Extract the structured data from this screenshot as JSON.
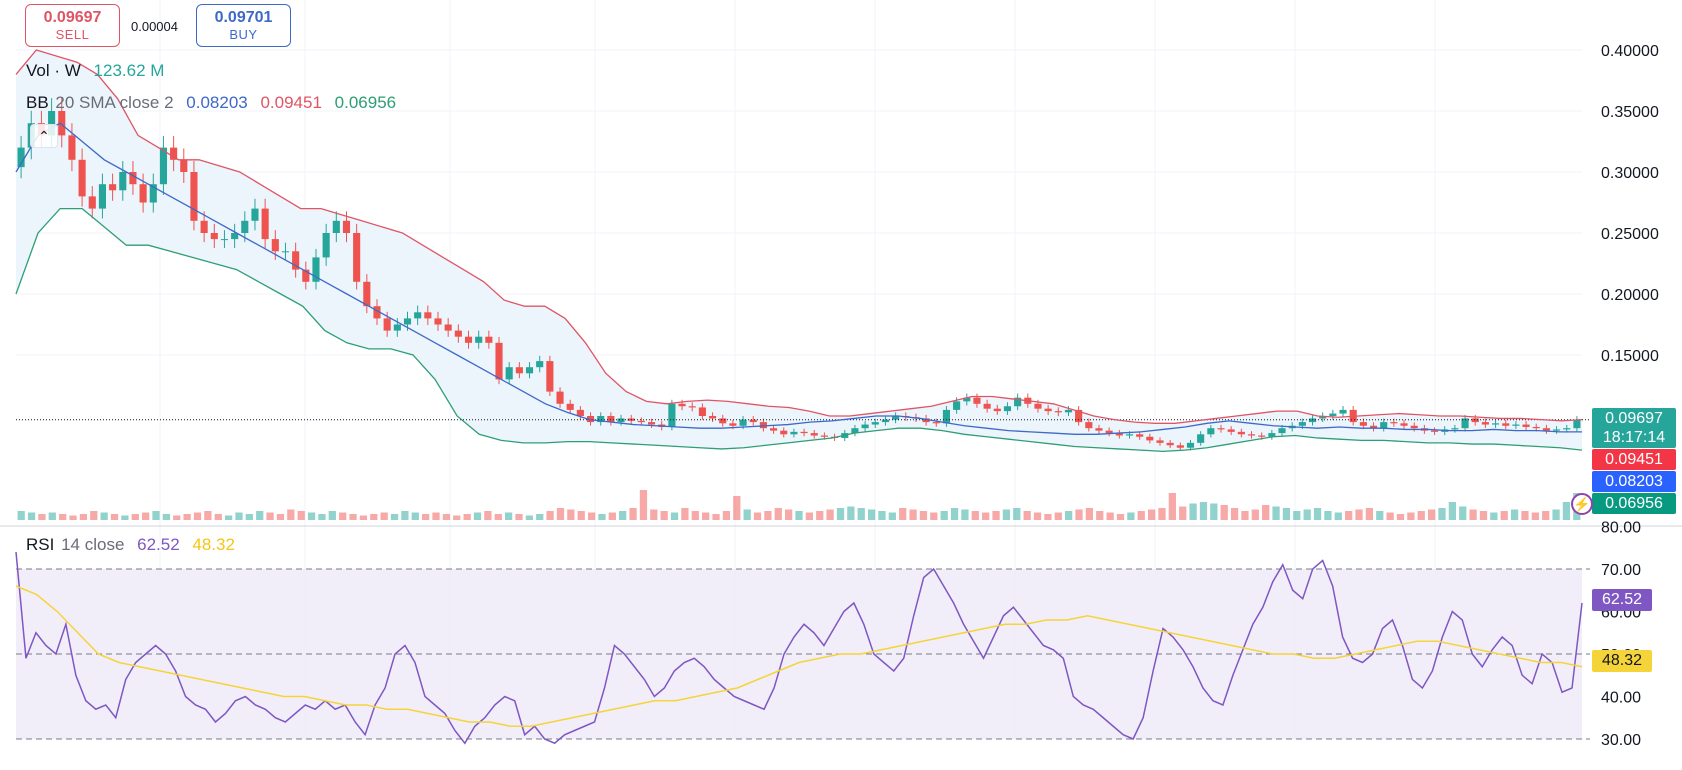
{
  "trade": {
    "sell_price": "0.09697",
    "sell_label": "SELL",
    "spread": "0.00004",
    "buy_price": "0.09701",
    "buy_label": "BUY"
  },
  "legends": {
    "vol_name": "Vol · W",
    "vol_value": "123.62 M",
    "bb_name": "BB",
    "bb_params": "20 SMA close 2",
    "bb_basis": "0.08203",
    "bb_upper": "0.09451",
    "bb_lower": "0.06956",
    "rsi_name": "RSI",
    "rsi_params": "14 close",
    "rsi_value": "62.52",
    "rsi_ma": "48.32"
  },
  "price_tags": {
    "last": "0.09697",
    "countdown": "18:17:14",
    "upper": "0.09451",
    "basis": "0.08203",
    "lower": "0.06956",
    "rsi": "62.52",
    "rsi_ma": "48.32"
  },
  "colors": {
    "up": "#26a69a",
    "down": "#ef5350",
    "upper_band": "#e05565",
    "basis": "#3d69c9",
    "lower_band": "#2e9e74",
    "rsi": "#7e57c2",
    "rsi_ma": "#f5d43a",
    "band_fill": "#eaf3fc",
    "rsi_fill": "#ede7f6"
  },
  "chart_data": [
    {
      "type": "candlestick",
      "interval": "W",
      "ylim": [
        0.06,
        0.41
      ],
      "y_ticks": [
        "0.40000",
        "0.35000",
        "0.30000",
        "0.25000",
        "0.20000",
        "0.15000"
      ],
      "last_price": 0.09697,
      "close": [
        0.32,
        0.34,
        0.33,
        0.35,
        0.33,
        0.31,
        0.28,
        0.27,
        0.29,
        0.285,
        0.3,
        0.29,
        0.275,
        0.29,
        0.32,
        0.31,
        0.3,
        0.26,
        0.25,
        0.245,
        0.245,
        0.25,
        0.26,
        0.27,
        0.245,
        0.235,
        0.235,
        0.22,
        0.21,
        0.23,
        0.25,
        0.26,
        0.25,
        0.21,
        0.19,
        0.18,
        0.17,
        0.175,
        0.18,
        0.185,
        0.18,
        0.175,
        0.17,
        0.165,
        0.16,
        0.165,
        0.16,
        0.13,
        0.14,
        0.135,
        0.14,
        0.145,
        0.12,
        0.11,
        0.105,
        0.1,
        0.095,
        0.1,
        0.095,
        0.098,
        0.096,
        0.095,
        0.093,
        0.091,
        0.11,
        0.108,
        0.107,
        0.1,
        0.098,
        0.094,
        0.092,
        0.097,
        0.095,
        0.09,
        0.088,
        0.085,
        0.087,
        0.086,
        0.084,
        0.083,
        0.082,
        0.086,
        0.09,
        0.093,
        0.095,
        0.097,
        0.1,
        0.099,
        0.098,
        0.095,
        0.094,
        0.105,
        0.112,
        0.115,
        0.11,
        0.106,
        0.104,
        0.108,
        0.115,
        0.11,
        0.106,
        0.104,
        0.103,
        0.105,
        0.095,
        0.09,
        0.088,
        0.086,
        0.084,
        0.085,
        0.083,
        0.08,
        0.078,
        0.076,
        0.074,
        0.078,
        0.085,
        0.09,
        0.089,
        0.087,
        0.085,
        0.084,
        0.083,
        0.086,
        0.09,
        0.092,
        0.095,
        0.098,
        0.1,
        0.102,
        0.105,
        0.095,
        0.092,
        0.09,
        0.095,
        0.094,
        0.092,
        0.09,
        0.088,
        0.087,
        0.089,
        0.09,
        0.098,
        0.095,
        0.093,
        0.094,
        0.092,
        0.093,
        0.091,
        0.09,
        0.088,
        0.089,
        0.09,
        0.097
      ],
      "bb_upper_trace": [
        0.38,
        0.4,
        0.395,
        0.39,
        0.38,
        0.36,
        0.33,
        0.32,
        0.31,
        0.31,
        0.305,
        0.3,
        0.29,
        0.28,
        0.27,
        0.27,
        0.265,
        0.26,
        0.255,
        0.25,
        0.24,
        0.23,
        0.22,
        0.21,
        0.195,
        0.19,
        0.19,
        0.18,
        0.16,
        0.135,
        0.12,
        0.112,
        0.11,
        0.112,
        0.113,
        0.112,
        0.11,
        0.108,
        0.107,
        0.104,
        0.1,
        0.1,
        0.102,
        0.104,
        0.106,
        0.108,
        0.112,
        0.116,
        0.116,
        0.114,
        0.112,
        0.11,
        0.105,
        0.1,
        0.097,
        0.095,
        0.094,
        0.094,
        0.096,
        0.098,
        0.1,
        0.102,
        0.104,
        0.104,
        0.1,
        0.099,
        0.1,
        0.101,
        0.102,
        0.101,
        0.1,
        0.1,
        0.099,
        0.098,
        0.098,
        0.097,
        0.096,
        0.097
      ],
      "bb_basis_trace": [
        0.3,
        0.33,
        0.34,
        0.325,
        0.31,
        0.3,
        0.29,
        0.28,
        0.27,
        0.26,
        0.25,
        0.24,
        0.23,
        0.22,
        0.21,
        0.2,
        0.19,
        0.18,
        0.17,
        0.16,
        0.15,
        0.14,
        0.13,
        0.12,
        0.11,
        0.103,
        0.097,
        0.095,
        0.093,
        0.092,
        0.091,
        0.09,
        0.09,
        0.091,
        0.092,
        0.093,
        0.095,
        0.096,
        0.098,
        0.1,
        0.1,
        0.098,
        0.095,
        0.092,
        0.09,
        0.088,
        0.087,
        0.086,
        0.085,
        0.085,
        0.086,
        0.087,
        0.089,
        0.091,
        0.094,
        0.096,
        0.094,
        0.092,
        0.091,
        0.09,
        0.091,
        0.09,
        0.09,
        0.089,
        0.089,
        0.088,
        0.088,
        0.089,
        0.088,
        0.088,
        0.087,
        0.087
      ],
      "bb_lower_trace": [
        0.2,
        0.25,
        0.27,
        0.27,
        0.255,
        0.24,
        0.24,
        0.235,
        0.23,
        0.225,
        0.22,
        0.21,
        0.2,
        0.19,
        0.17,
        0.16,
        0.155,
        0.155,
        0.15,
        0.13,
        0.1,
        0.085,
        0.08,
        0.078,
        0.078,
        0.079,
        0.079,
        0.078,
        0.077,
        0.076,
        0.075,
        0.074,
        0.073,
        0.074,
        0.076,
        0.078,
        0.08,
        0.082,
        0.086,
        0.088,
        0.09,
        0.09,
        0.088,
        0.085,
        0.083,
        0.081,
        0.079,
        0.077,
        0.075,
        0.074,
        0.073,
        0.072,
        0.071,
        0.072,
        0.074,
        0.077,
        0.08,
        0.083,
        0.084,
        0.082,
        0.081,
        0.08,
        0.08,
        0.079,
        0.078,
        0.078,
        0.077,
        0.077,
        0.076,
        0.075,
        0.074,
        0.072
      ]
    },
    {
      "type": "bar",
      "title": "Vol · W",
      "last_value": "123.62 M",
      "relative_values": [
        0.3,
        0.25,
        0.2,
        0.25,
        0.2,
        0.15,
        0.2,
        0.3,
        0.25,
        0.2,
        0.15,
        0.2,
        0.25,
        0.3,
        0.2,
        0.15,
        0.2,
        0.25,
        0.3,
        0.2,
        0.15,
        0.25,
        0.2,
        0.3,
        0.25,
        0.2,
        0.35,
        0.3,
        0.25,
        0.2,
        0.3,
        0.25,
        0.2,
        0.15,
        0.2,
        0.25,
        0.2,
        0.3,
        0.25,
        0.2,
        0.25,
        0.2,
        0.15,
        0.2,
        0.25,
        0.3,
        0.2,
        0.25,
        0.2,
        0.15,
        0.2,
        0.3,
        0.4,
        0.35,
        0.3,
        0.25,
        0.2,
        0.25,
        0.3,
        0.4,
        1.0,
        0.35,
        0.3,
        0.25,
        0.4,
        0.3,
        0.25,
        0.2,
        0.3,
        0.8,
        0.35,
        0.25,
        0.3,
        0.4,
        0.35,
        0.3,
        0.25,
        0.3,
        0.35,
        0.4,
        0.45,
        0.4,
        0.35,
        0.3,
        0.25,
        0.4,
        0.35,
        0.3,
        0.25,
        0.3,
        0.4,
        0.35,
        0.3,
        0.25,
        0.3,
        0.35,
        0.4,
        0.3,
        0.25,
        0.2,
        0.25,
        0.3,
        0.35,
        0.4,
        0.3,
        0.25,
        0.2,
        0.25,
        0.3,
        0.35,
        0.4,
        0.9,
        0.45,
        0.55,
        0.6,
        0.55,
        0.5,
        0.4,
        0.3,
        0.35,
        0.5,
        0.45,
        0.4,
        0.3,
        0.35,
        0.4,
        0.3,
        0.25,
        0.3,
        0.35,
        0.4,
        0.3,
        0.25,
        0.2,
        0.25,
        0.3,
        0.35,
        0.4,
        0.6,
        0.45,
        0.35,
        0.3,
        0.25,
        0.3,
        0.35,
        0.3,
        0.25,
        0.3,
        0.35,
        0.6,
        0.9
      ]
    },
    {
      "type": "line",
      "title": "RSI 14 close",
      "ylim": [
        30,
        80
      ],
      "y_ticks": [
        "80.00",
        "70.00",
        "60.00",
        "50.00",
        "40.00",
        "30.00"
      ],
      "bands": [
        30,
        50,
        70
      ],
      "series": [
        {
          "name": "RSI",
          "values": [
            74,
            49,
            55,
            52,
            50,
            57,
            45,
            39,
            37,
            38,
            35,
            44,
            48,
            50,
            52,
            50,
            46,
            40,
            38,
            37,
            34,
            36,
            39,
            40,
            38,
            37,
            35,
            34,
            36,
            38,
            37,
            39,
            37,
            38,
            34,
            31,
            38,
            42,
            50,
            52,
            48,
            40,
            38,
            36,
            32,
            29,
            33,
            35,
            38,
            40,
            39,
            31,
            33,
            30,
            29,
            31,
            32,
            33,
            34,
            42,
            52,
            50,
            47,
            44,
            40,
            42,
            46,
            48,
            49,
            47,
            44,
            42,
            40,
            39,
            38,
            37,
            42,
            50,
            54,
            57,
            55,
            52,
            56,
            60,
            62,
            57,
            50,
            48,
            46,
            49,
            59,
            68,
            70,
            66,
            62,
            57,
            53,
            49,
            54,
            59,
            61,
            58,
            55,
            52,
            51,
            49,
            40,
            38,
            37,
            35,
            33,
            31,
            30,
            35,
            46,
            56,
            54,
            51,
            47,
            42,
            39,
            38,
            45,
            51,
            57,
            61,
            67,
            71,
            65,
            63,
            70,
            72,
            66,
            54,
            49,
            48,
            50,
            56,
            58,
            52,
            44,
            42,
            46,
            54,
            60,
            58,
            50,
            47,
            51,
            54,
            52,
            45,
            43,
            50,
            48,
            41,
            42,
            62
          ]
        },
        {
          "name": "MA",
          "values": [
            66,
            64,
            60,
            55,
            50,
            48,
            47,
            46,
            45,
            44,
            43,
            42,
            41,
            40,
            40,
            39,
            38,
            38,
            37,
            37,
            36,
            35,
            34,
            34,
            33,
            33,
            34,
            35,
            36,
            37,
            38,
            39,
            39,
            40,
            41,
            42,
            44,
            46,
            48,
            49,
            50,
            50,
            51,
            52,
            53,
            54,
            55,
            56,
            57,
            57,
            58,
            58,
            59,
            58,
            57,
            56,
            55,
            54,
            53,
            52,
            51,
            50,
            50,
            49,
            49,
            50,
            51,
            52,
            53,
            53,
            52,
            51,
            50,
            49,
            48,
            48,
            47
          ]
        }
      ]
    }
  ]
}
